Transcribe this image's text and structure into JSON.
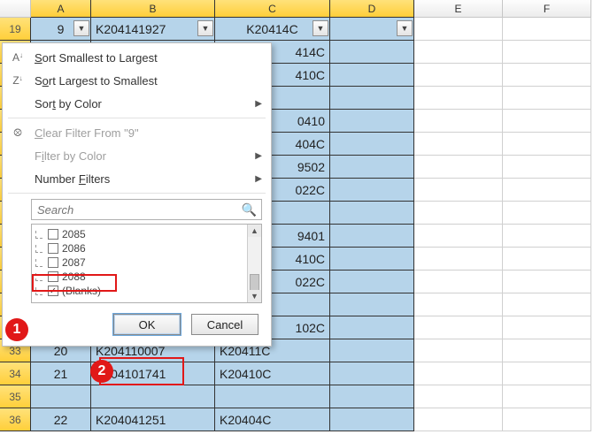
{
  "columns": {
    "A": "A",
    "B": "B",
    "C": "C",
    "D": "D",
    "E": "E",
    "F": "F"
  },
  "filter_column_ref": "9",
  "header_row": {
    "num": "19",
    "A": "9",
    "B": "K204141927",
    "C": "K20414C",
    "D": ""
  },
  "visible_partial_C": [
    "414C",
    "410C",
    "",
    "0410",
    "404C",
    "9502",
    "022C",
    "",
    "9401",
    "410C",
    "022C",
    "",
    "102C"
  ],
  "bottom_rows": [
    {
      "num": "33",
      "A": "20",
      "B": "K204110007",
      "C": "K20411C"
    },
    {
      "num": "34",
      "A": "21",
      "B": "K204101741",
      "C": "K20410C"
    },
    {
      "num": "35",
      "A": "",
      "B": "",
      "C": ""
    },
    {
      "num": "36",
      "A": "22",
      "B": "K204041251",
      "C": "K20404C"
    }
  ],
  "menu": {
    "sort_asc": "Sort Smallest to Largest",
    "sort_desc": "Sort Largest to Smallest",
    "sort_color": "Sort by Color",
    "clear_filter": "Clear Filter From \"9\"",
    "filter_color": "Filter by Color",
    "number_filters": "Number Filters",
    "search_placeholder": "Search"
  },
  "checklist": {
    "items": [
      "2085",
      "2086",
      "2087",
      "2088"
    ],
    "blanks_label": "(Blanks)",
    "blanks_checked": true
  },
  "buttons": {
    "ok": "OK",
    "cancel": "Cancel"
  },
  "annotations": {
    "one": "1",
    "two": "2"
  },
  "icons": {
    "sort_asc": "A↓Z",
    "sort_desc": "Z↓A",
    "funnel": "▾",
    "arrow": "▶",
    "search": "🔍",
    "dropdown": "▼",
    "scroll_up": "▲",
    "scroll_down": "▼",
    "check": "✓"
  }
}
